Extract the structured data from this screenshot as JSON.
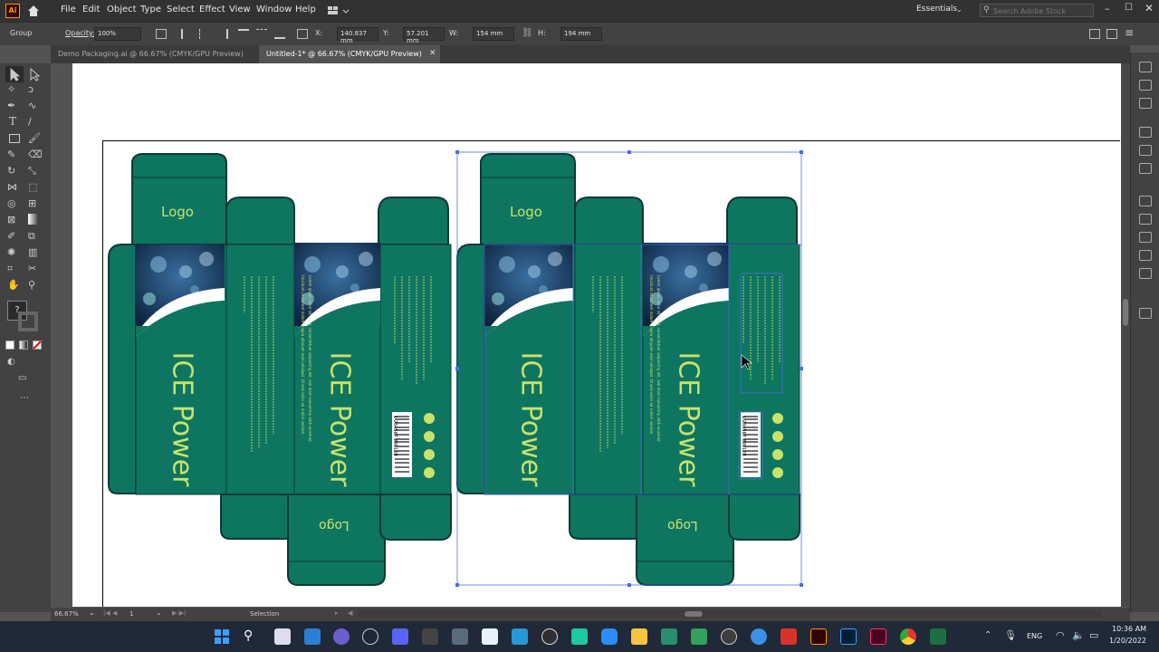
{
  "app": {
    "logo_text": "Ai",
    "menus": [
      "File",
      "Edit",
      "Object",
      "Type",
      "Select",
      "Effect",
      "View",
      "Window",
      "Help"
    ],
    "workspace": "Essentials",
    "search_placeholder": "Search Adobe Stock"
  },
  "control_bar": {
    "selection_type": "Group",
    "opacity_label": "Opacity:",
    "opacity_value": "100%",
    "x_label": "X:",
    "x_value": "140.837 mm",
    "y_label": "Y:",
    "y_value": "57.201 mm",
    "w_label": "W:",
    "w_value": "154 mm",
    "h_label": "H:",
    "h_value": "194 mm"
  },
  "tabs": [
    {
      "label": "Demo Packaging.ai @ 66.67% (CMYK/GPU Preview)",
      "active": false
    },
    {
      "label": "Untitled-1* @ 66.67% (CMYK/GPU Preview)",
      "active": true
    }
  ],
  "artwork": {
    "logo": "Logo",
    "product_name": "ICE Power",
    "body_copy": "Lorem ipsum dolor sit amet, consectetuer adipiscing elit, sed diam nonummy nibh euismod tincidunt ut laoreet dolore magna aliquam erat volutpat. Ut wisi enim ad minim veniam",
    "barcode_number": "1 234567 890128",
    "colors": {
      "box_fill": "#0e7561",
      "box_stroke": "#0b3b33",
      "title": "#c8e26a",
      "selection": "#4a6ee0"
    }
  },
  "status": {
    "zoom": "66.67%",
    "artboard": "1",
    "tool": "Selection"
  },
  "taskbar": {
    "language": "ENG",
    "time": "10:36 AM",
    "date": "1/20/2022"
  }
}
